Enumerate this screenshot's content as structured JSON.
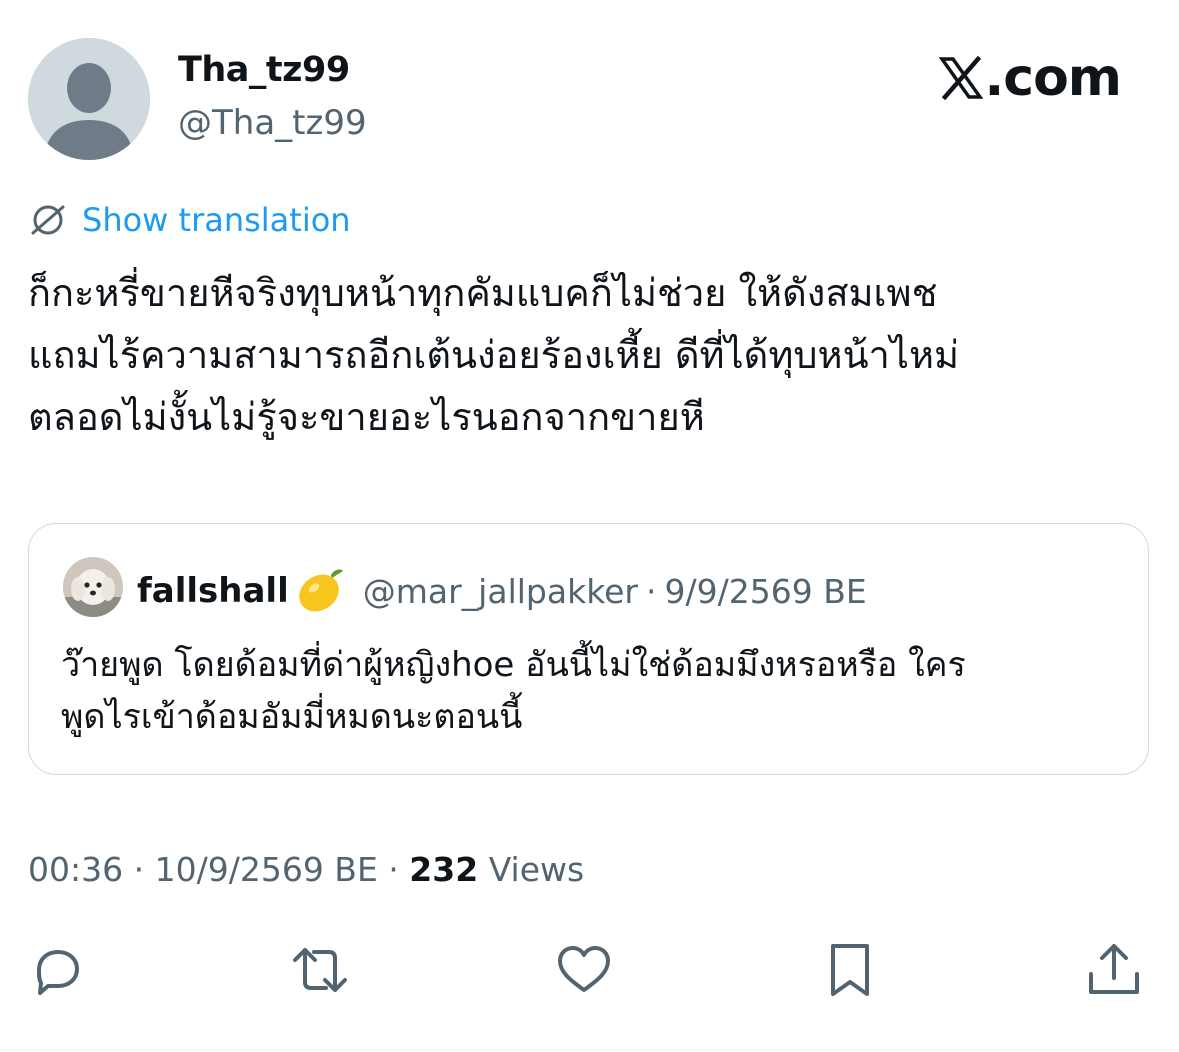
{
  "author": {
    "display_name": "Tha_tz99",
    "handle": "@Tha_tz99",
    "avatar_icon": "default-user-avatar"
  },
  "brand": {
    "label": ".com",
    "icon": "x-logo-icon"
  },
  "translation": {
    "label": "Show translation",
    "icon": "globe-icon"
  },
  "tweet": {
    "lines": [
      "ก็กะหรี่ขายหีจริงทุบหน้าทุกคัมแบคก็ไม่ช่วย ให้ดังสมเพช",
      "แถมไร้ความสามารถอีกเต้นง่อยร้องเหี้ย ดีที่ได้ทุบหน้าไหม่",
      "ตลอดไม่งั้นไม่รู้จะขายอะไรนอกจากขายหี"
    ]
  },
  "quote": {
    "display_name": "fallshall",
    "emoji": "lemon-icon",
    "handle": "@mar_jallpakker",
    "separator": "·",
    "date": "9/9/2569 BE",
    "lines": [
      "ว๊ายพูด โดยด้อมที่ด่าผู้หญิงhoe อันนี้ไม่ใช่ด้อมมึงหรอหรือ ใคร",
      "พูดไรเข้าด้อมอัมมี่หมดนะตอนนี้"
    ]
  },
  "meta": {
    "time": "00:36",
    "separator": "·",
    "date": "10/9/2569 BE",
    "views_count": "232",
    "views_label": "Views"
  },
  "actions": [
    {
      "name": "reply",
      "icon": "reply-icon"
    },
    {
      "name": "repost",
      "icon": "repost-icon"
    },
    {
      "name": "like",
      "icon": "heart-icon"
    },
    {
      "name": "bookmark",
      "icon": "bookmark-icon"
    },
    {
      "name": "share",
      "icon": "share-icon"
    }
  ],
  "colors": {
    "text_primary": "#0f1419",
    "text_secondary": "#536471",
    "link_blue": "#1d9bf0",
    "border": "#cfd9de",
    "avatar_bg": "#cfd9de",
    "avatar_figure": "#6f7c87"
  }
}
